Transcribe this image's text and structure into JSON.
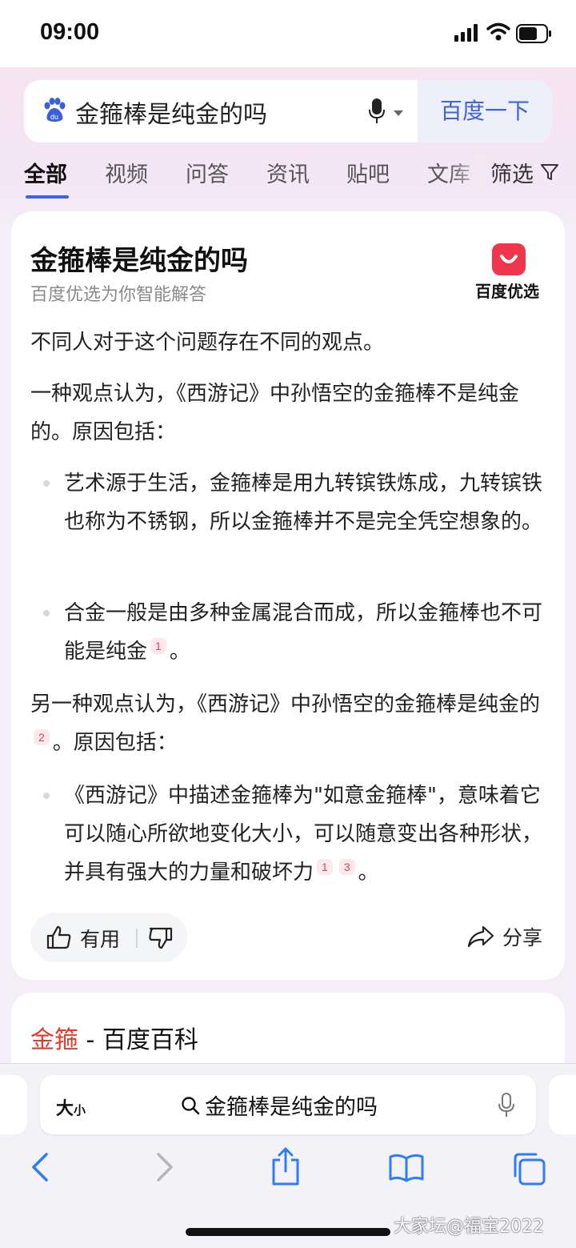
{
  "status_bar": {
    "time": "09:00"
  },
  "search": {
    "query": "金箍棒是纯金的吗",
    "button_label": "百度一下"
  },
  "tabs": [
    {
      "label": "全部",
      "active": true
    },
    {
      "label": "视频"
    },
    {
      "label": "问答"
    },
    {
      "label": "资讯"
    },
    {
      "label": "贴吧"
    },
    {
      "label": "文库"
    }
  ],
  "filter_label": "筛选",
  "answer_card": {
    "title": "金箍棒是纯金的吗",
    "subtitle": "百度优选为你智能解答",
    "brand": "百度优选",
    "intro": "不同人对于这个问题存在不同的观点。",
    "view1_intro": "一种观点认为，《西游记》中孙悟空的金箍棒不是纯金的。原因包括：",
    "view1_points": [
      {
        "text": "艺术源于生活，金箍棒是用九转镔铁炼成，九转镔铁也称为不锈钢，所以金箍棒并不是完全凭空想象的。"
      },
      {
        "text": "合金一般是由多种金属混合而成，所以金箍棒也不可能是纯金",
        "cites": [
          "1"
        ],
        "tail": "。"
      }
    ],
    "view2_intro_a": "另一种观点认为，《西游记》中孙悟空的金箍棒是纯金的",
    "view2_cite": "2",
    "view2_intro_b": "。原因包括：",
    "view2_points": [
      {
        "text": "《西游记》中描述金箍棒为\"如意金箍棒\"，意味着它可以随心所欲地变化大小，可以随意变出各种形状，并具有强大的力量和破坏力",
        "cites": [
          "1",
          "3"
        ],
        "tail": "。"
      }
    ],
    "useful_label": "有用",
    "share_label": "分享"
  },
  "baike_card": {
    "title_highlight": "金箍",
    "title_rest": " - 百度百科"
  },
  "safari": {
    "aa_big": "大",
    "aa_small": "小",
    "url_text": "金箍棒是纯金的吗"
  },
  "watermark": "大家坛@福宝2022",
  "colors": {
    "accent_blue": "#3d63dd",
    "brand_red": "#f0364c",
    "cite_red": "#e0405a"
  }
}
